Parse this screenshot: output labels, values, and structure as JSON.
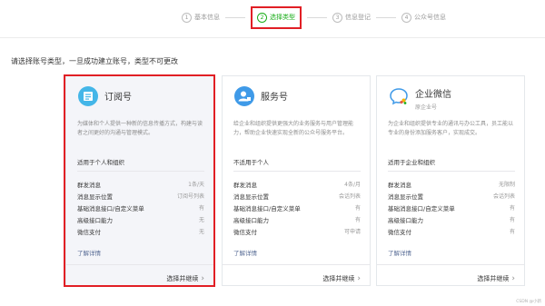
{
  "steps": [
    {
      "num": "1",
      "label": "基本信息"
    },
    {
      "num": "2",
      "label": "选择类型"
    },
    {
      "num": "3",
      "label": "信息登记"
    },
    {
      "num": "4",
      "label": "公众号信息"
    }
  ],
  "prompt": "请选择账号类型，一旦成功建立账号，类型不可更改",
  "cards": [
    {
      "title": "订阅号",
      "subtitle": "",
      "desc": "为媒体和个人提供一种新的信息传播方式，构建与读者之间更好的沟通与管理模式。",
      "fit": "适用于个人和组织",
      "features": [
        {
          "k": "群发消息",
          "v": "1条/天"
        },
        {
          "k": "消息显示位置",
          "v": "订阅号列表"
        },
        {
          "k": "基础消息接口/自定义菜单",
          "v": "有"
        },
        {
          "k": "高级接口能力",
          "v": "无"
        },
        {
          "k": "微信支付",
          "v": "无"
        }
      ],
      "more": "了解详情",
      "action": "选择并继续"
    },
    {
      "title": "服务号",
      "subtitle": "",
      "desc": "给企业和组织提供更强大的业务服务与用户管理能力，帮助企业快速实现全新的公众号服务平台。",
      "fit": "不适用于个人",
      "features": [
        {
          "k": "群发消息",
          "v": "4条/月"
        },
        {
          "k": "消息显示位置",
          "v": "会话列表"
        },
        {
          "k": "基础消息接口/自定义菜单",
          "v": "有"
        },
        {
          "k": "高级接口能力",
          "v": "有"
        },
        {
          "k": "微信支付",
          "v": "可申请"
        }
      ],
      "more": "了解详情",
      "action": "选择并继续"
    },
    {
      "title": "企业微信",
      "subtitle": "原企业号",
      "desc": "为企业和组织提供专业的通讯与办公工具，员工能以专业的身份添加服务客户，实现成交。",
      "fit": "适用于企业和组织",
      "features": [
        {
          "k": "群发消息",
          "v": "无限制"
        },
        {
          "k": "消息显示位置",
          "v": "会话列表"
        },
        {
          "k": "基础消息接口/自定义菜单",
          "v": "有"
        },
        {
          "k": "高级接口能力",
          "v": "有"
        },
        {
          "k": "微信支付",
          "v": "有"
        }
      ],
      "more": "了解详情",
      "action": "选择并继续"
    }
  ],
  "watermark": "CSDN @小新",
  "colors": {
    "accent": "#1aad19",
    "highlight": "#e11f25",
    "link": "#576b95"
  },
  "icons": [
    "subscription-icon",
    "service-icon",
    "wecom-icon"
  ]
}
